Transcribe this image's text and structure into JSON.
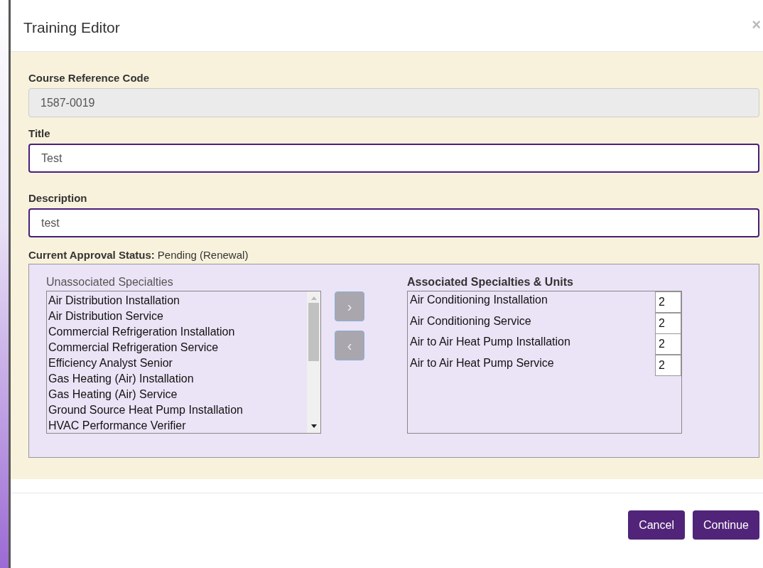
{
  "dialog": {
    "title": "Training Editor",
    "close": "×"
  },
  "fields": [
    {
      "label": "Course Reference Code",
      "value": "1587-0019",
      "disabled": true
    },
    {
      "label": "Title",
      "value": "Test",
      "disabled": false
    },
    {
      "label": "Description",
      "value": "test",
      "disabled": false
    }
  ],
  "approval_status": {
    "label": "Current Approval Status:",
    "value": "Pending (Renewal)"
  },
  "unassociated": {
    "label": "Unassociated Specialties",
    "items": [
      "Air Distribution Installation",
      "Air Distribution Service",
      "Commercial Refrigeration Installation",
      "Commercial Refrigeration Service",
      "Efficiency Analyst Senior",
      "Gas Heating (Air) Installation",
      "Gas Heating (Air) Service",
      "Ground Source Heat Pump Installation",
      "HVAC Performance Verifier"
    ]
  },
  "move_buttons": [
    {
      "label": "›"
    },
    {
      "label": "‹"
    }
  ],
  "associated": {
    "label": "Associated Specialties & Units",
    "rows": [
      {
        "name": "Air Conditioning Installation",
        "units": "2"
      },
      {
        "name": "Air Conditioning Service",
        "units": "2"
      },
      {
        "name": "Air to Air Heat Pump Installation",
        "units": "2"
      },
      {
        "name": "Air to Air Heat Pump Service",
        "units": "2"
      }
    ]
  },
  "buttons": [
    {
      "label": "Cancel"
    },
    {
      "label": "Continue"
    }
  ]
}
